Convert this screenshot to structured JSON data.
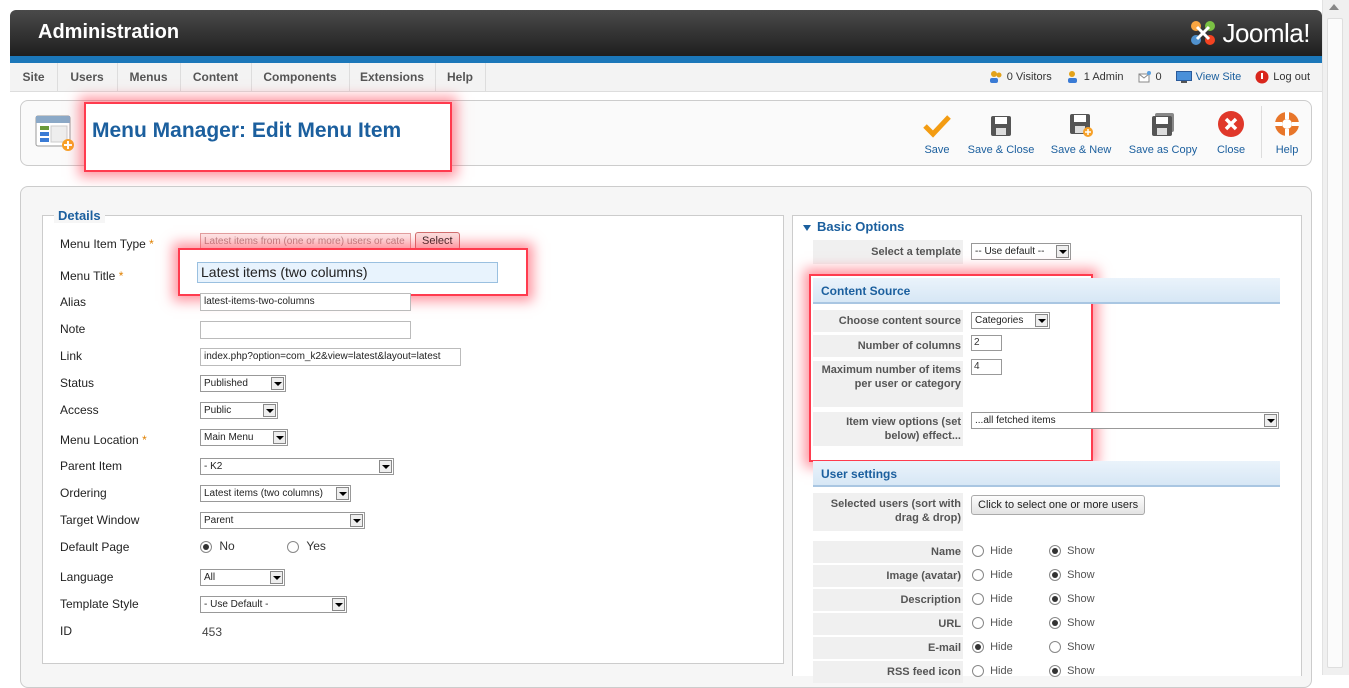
{
  "header": {
    "title": "Administration",
    "logo_text": "Joomla!"
  },
  "menu": {
    "items": [
      "Site",
      "Users",
      "Menus",
      "Content",
      "Components",
      "Extensions",
      "Help"
    ]
  },
  "status": {
    "visitors": "0 Visitors",
    "admins": "1 Admin",
    "messages": "0",
    "view_site": "View Site",
    "logout": "Log out"
  },
  "toolbar": {
    "title": "Menu Manager: Edit Menu Item",
    "buttons": [
      "Save",
      "Save & Close",
      "Save & New",
      "Save as Copy",
      "Close",
      "Help"
    ]
  },
  "details": {
    "legend": "Details",
    "menu_item_type_label": "Menu Item Type",
    "menu_item_type_value": "Latest items from (one or more) users or cate",
    "select_label": "Select",
    "menu_title_label": "Menu Title",
    "menu_title_value": "Latest items (two columns)",
    "alias_label": "Alias",
    "alias_value": "latest-items-two-columns",
    "note_label": "Note",
    "note_value": "",
    "link_label": "Link",
    "link_value": "index.php?option=com_k2&view=latest&layout=latest",
    "status_label": "Status",
    "status_value": "Published",
    "access_label": "Access",
    "access_value": "Public",
    "menu_location_label": "Menu Location",
    "menu_location_value": "Main Menu",
    "parent_item_label": "Parent Item",
    "parent_item_value": "- K2",
    "ordering_label": "Ordering",
    "ordering_value": "Latest items (two columns)",
    "target_window_label": "Target Window",
    "target_window_value": "Parent",
    "default_page_label": "Default Page",
    "default_no": "No",
    "default_yes": "Yes",
    "language_label": "Language",
    "language_value": "All",
    "template_style_label": "Template Style",
    "template_style_value": "- Use Default -",
    "id_label": "ID",
    "id_value": "453",
    "required_mark": "*"
  },
  "options": {
    "basic_options": "Basic Options",
    "select_template_label": "Select a template",
    "select_template_value": "-- Use default --",
    "content_source_head": "Content Source",
    "choose_source_label": "Choose content source",
    "choose_source_value": "Categories",
    "num_columns_label": "Number of columns",
    "num_columns_value": "2",
    "max_items_label": "Maximum number of items per user or category",
    "max_items_value": "4",
    "item_view_label": "Item view options (set below) effect...",
    "item_view_value": "...all fetched items",
    "user_settings_head": "User settings",
    "selected_users_label": "Selected users (sort with drag & drop)",
    "selected_users_button": "Click to select one or more users",
    "hide": "Hide",
    "show": "Show",
    "toggles": [
      {
        "label": "Name",
        "selected": "show"
      },
      {
        "label": "Image (avatar)",
        "selected": "show"
      },
      {
        "label": "Description",
        "selected": "show"
      },
      {
        "label": "URL",
        "selected": "show"
      },
      {
        "label": "E-mail",
        "selected": "hide"
      },
      {
        "label": "RSS feed icon",
        "selected": "show"
      }
    ]
  }
}
